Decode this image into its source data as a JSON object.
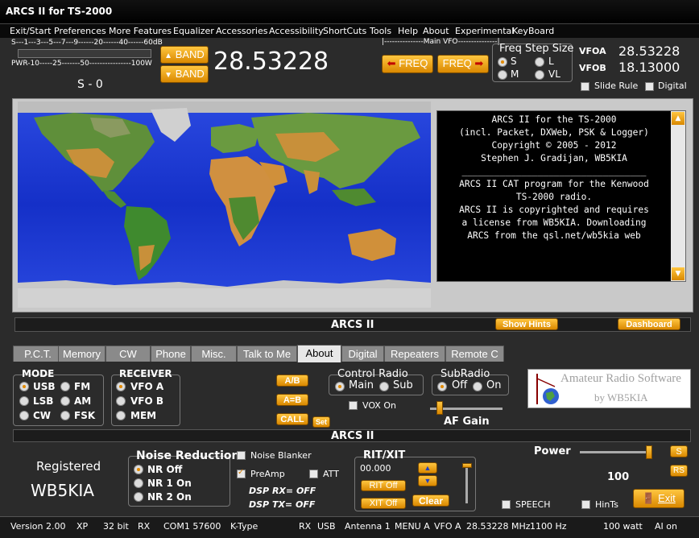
{
  "window": {
    "title": "ARCS II for TS-2000"
  },
  "menu": [
    "Exit/Start",
    "Preferences",
    "More Features",
    "Equalizer",
    "Accessories",
    "Accessibility",
    "ShortCuts",
    "Tools",
    "Help",
    "About",
    "Experimental",
    "KeyBoard"
  ],
  "meter": {
    "s_scale": "S---1---3---5---7---9------20------40------60dB",
    "pwr_scale": "PWR-10-----25-------50----------------100W",
    "s_reading": "S - 0"
  },
  "band": {
    "up_label": "BAND",
    "down_label": "BAND",
    "frequency": "28.53228"
  },
  "main_vfo": {
    "label": "|---------------Main VFO---------------|",
    "freq_down": "FREQ",
    "freq_up": "FREQ"
  },
  "freq_step": {
    "title": "Freq Step Size",
    "options": [
      "S",
      "L",
      "M",
      "VL"
    ],
    "selected": "S"
  },
  "vfo": {
    "a_label": "VFOA",
    "a_value": "28.53228",
    "b_label": "VFOB",
    "b_value": "18.13000"
  },
  "slide_rule": {
    "label": "Slide Rule",
    "checked": false
  },
  "digital": {
    "label": "Digital",
    "checked": false
  },
  "about_text": [
    "ARCS II for the TS-2000",
    "(incl. Packet, DXWeb, PSK & Logger)",
    "Copyright © 2005 - 2012",
    "Stephen J. Gradijan, WB5KIA",
    "",
    "__________________________________",
    "",
    "ARCS II CAT program for the Kenwood",
    "TS-2000 radio.",
    "",
    "",
    "ARCS II is copyrighted and requires",
    "a license from WB5KIA. Downloading",
    "ARCS from the qsl.net/wb5kia web"
  ],
  "panel1": {
    "title": "ARCS II",
    "show_hints": "Show Hints",
    "dashboard": "Dashboard"
  },
  "tabs": [
    "P.C.T.",
    "Memory",
    "CW",
    "Phone",
    "Misc.",
    "Talk to Me",
    "About",
    "Digital",
    "Repeaters",
    "Remote C"
  ],
  "active_tab": "About",
  "mode": {
    "title": "MODE",
    "options": [
      "USB",
      "FM",
      "LSB",
      "AM",
      "CW",
      "FSK"
    ],
    "selected": "USB"
  },
  "receiver": {
    "title": "RECEIVER",
    "options": [
      "VFO A",
      "VFO B",
      "MEM"
    ],
    "selected": "VFO A"
  },
  "vfo_buttons": {
    "ab": "A/B",
    "a_eq_b": "A=B",
    "call": "CALL",
    "set": "Set"
  },
  "control_radio": {
    "title": "Control Radio",
    "main": "Main",
    "sub": "Sub",
    "selected": "Main"
  },
  "vox": {
    "label": "VOX On",
    "checked": false
  },
  "subradio": {
    "title": "SubRadio",
    "off": "Off",
    "on": "On",
    "selected": "Off"
  },
  "af_gain": {
    "label": "AF Gain",
    "level": 0.1
  },
  "logo": {
    "line1": "Amateur Radio Software",
    "line2": "by WB5KIA"
  },
  "panel2": {
    "title": "ARCS II"
  },
  "registration": {
    "label": "Registered",
    "callsign": "WB5KIA"
  },
  "noise_reduction": {
    "title": "Noise Reduction",
    "options": [
      "NR Off",
      "NR 1 On",
      "NR 2 On"
    ],
    "selected": "NR Off"
  },
  "noise_blanker": {
    "label": "Noise Blanker",
    "checked": false
  },
  "preamp": {
    "label": "PreAmp",
    "checked": true
  },
  "att": {
    "label": "ATT",
    "checked": false
  },
  "dsp": {
    "rx": "DSP RX= OFF",
    "tx": "DSP TX= OFF"
  },
  "rit_xit": {
    "title": "RIT/XIT",
    "value": "00.000",
    "rit_off": "RIT Off",
    "xit_off": "XIT Off",
    "clear": "Clear"
  },
  "power": {
    "label": "Power",
    "value": "100",
    "s_btn": "S",
    "rs_btn": "RS",
    "level": 1.0
  },
  "speech": {
    "label": "SPEECH",
    "checked": false
  },
  "hints": {
    "label": "HinTs",
    "checked": false
  },
  "exit_button": {
    "label": "Exit"
  },
  "status": [
    "Version 2.00",
    "XP",
    "32 bit",
    "RX",
    "COM1 57600",
    "K-Type",
    "RX",
    "USB",
    "Antenna 1",
    "MENU A",
    "VFO A",
    "28.53228 MHz",
    "1100 Hz",
    "100 watt",
    "AI on"
  ],
  "colors": {
    "accent": "#e39200",
    "background": "#2b2b2b",
    "ocean": "#1a35d8"
  }
}
